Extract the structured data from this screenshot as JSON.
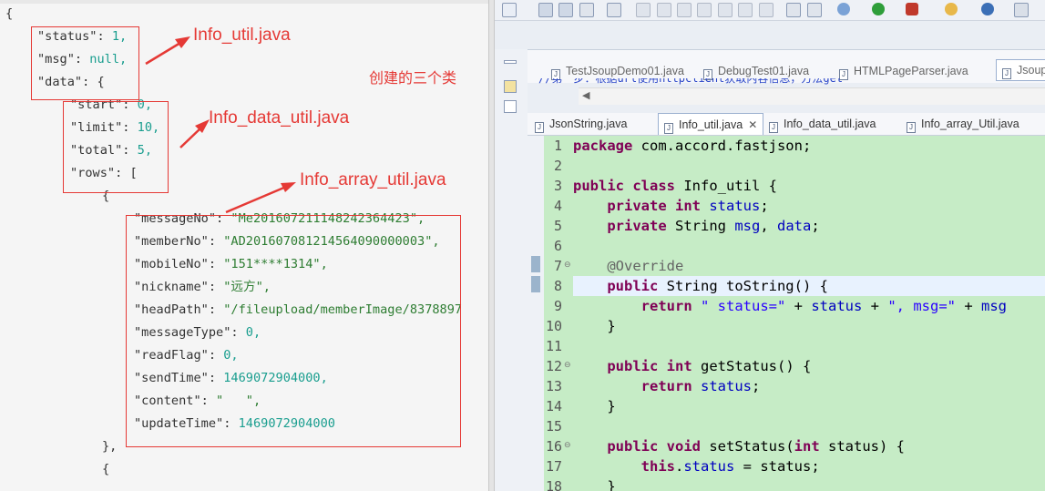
{
  "left": {
    "json_lines": [
      "{",
      "\"status\": 1,",
      "\"msg\": null,",
      "\"data\": {",
      "\"start\": 0,",
      "\"limit\": 10,",
      "\"total\": 5,",
      "\"rows\": [",
      "{",
      "\"messageNo\": \"Me201607211148242364423\",",
      "\"memberNo\": \"AD201607081214564090000003\",",
      "\"mobileNo\": \"151****1314\",",
      "\"nickname\": \"远方\",",
      "\"headPath\": \"/fileupload/memberImage/8378897",
      "\"messageType\": 0,",
      "\"readFlag\": 0,",
      "\"sendTime\": 1469072904000,",
      "\"content\": \"   \",",
      "\"updateTime\": 1469072904000",
      "},",
      "{"
    ],
    "annotations": {
      "info_util": "Info_util.java",
      "info_data_util": "Info_data_util.java",
      "info_array_util": "Info_array_util.java",
      "three_classes": "创建的三个类"
    },
    "annotation_color": "#e53935"
  },
  "ide": {
    "top_tabs": [
      "TestJsoupDemo01.java",
      "DebugTest01.java",
      "HTMLPageParser.java",
      "Jsoup"
    ],
    "bleed_text": "//第一步：根据url使用httpclient获取内容信息，方法get",
    "editor_tabs": [
      "JsonString.java",
      "Info_util.java",
      "Info_data_util.java",
      "Info_array_Util.java"
    ],
    "active_editor_tab": "Info_util.java",
    "line_numbers": [
      "1",
      "2",
      "3",
      "4",
      "5",
      "6",
      "7",
      "8",
      "9",
      "10",
      "11",
      "12",
      "13",
      "14",
      "15",
      "16",
      "17",
      "18"
    ],
    "code_lines": [
      "package com.accord.fastjson;",
      "",
      "public class Info_util {",
      "    private int status;",
      "    private String msg, data;",
      "",
      "    @Override",
      "    public String toString() {",
      "        return \" status=\" + status + \", msg=\" + msg",
      "    }",
      "",
      "    public int getStatus() {",
      "        return status;",
      "    }",
      "",
      "    public void setStatus(int status) {",
      "        this.status = status;",
      "    }"
    ],
    "editor_bg": "#c6ecc6"
  }
}
